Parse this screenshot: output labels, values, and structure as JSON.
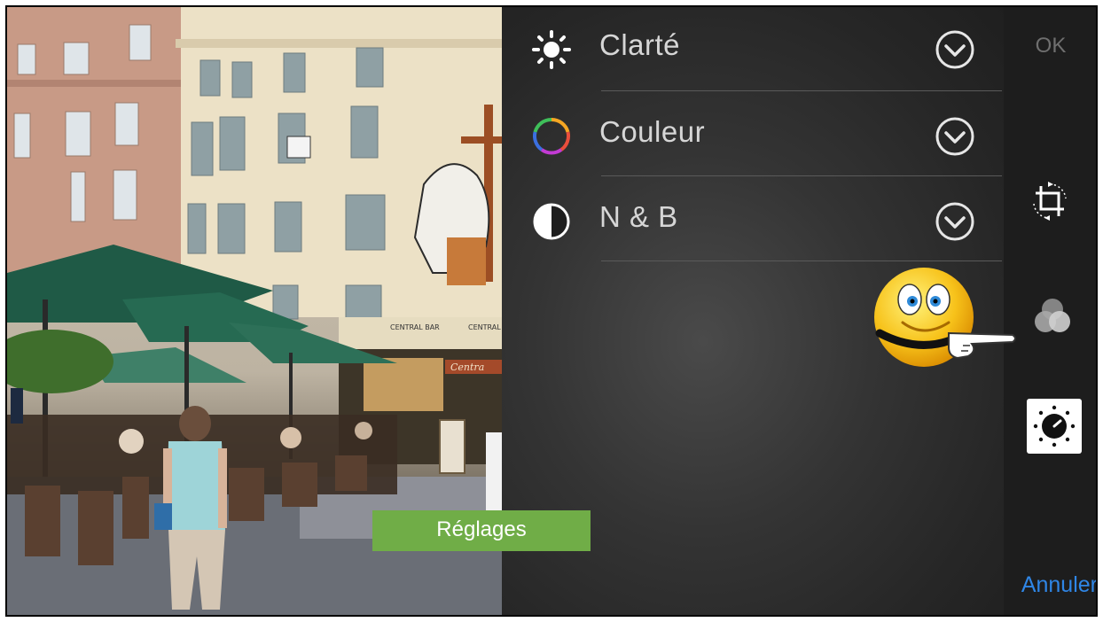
{
  "adjustments": [
    {
      "label": "Clarté",
      "icon": "sun-icon"
    },
    {
      "label": "Couleur",
      "icon": "color-wheel-icon"
    },
    {
      "label": "N & B",
      "icon": "half-circle-icon"
    }
  ],
  "toolbar": {
    "ok_label": "OK",
    "cancel_label": "Annuler",
    "tools": [
      "crop-rotate-icon",
      "filters-icon",
      "adjust-dial-icon"
    ],
    "selected_tool": "adjust-dial-icon"
  },
  "photo": {
    "sign_central_bar": "CENTRAL BAR",
    "sign_central": "CENTRAL",
    "sign_awning": "Centra"
  },
  "caption": {
    "label": "Réglages"
  },
  "colors": {
    "cancel": "#2f86e6",
    "caption_bg": "#70ad47",
    "ok": "#6f6f6f"
  }
}
